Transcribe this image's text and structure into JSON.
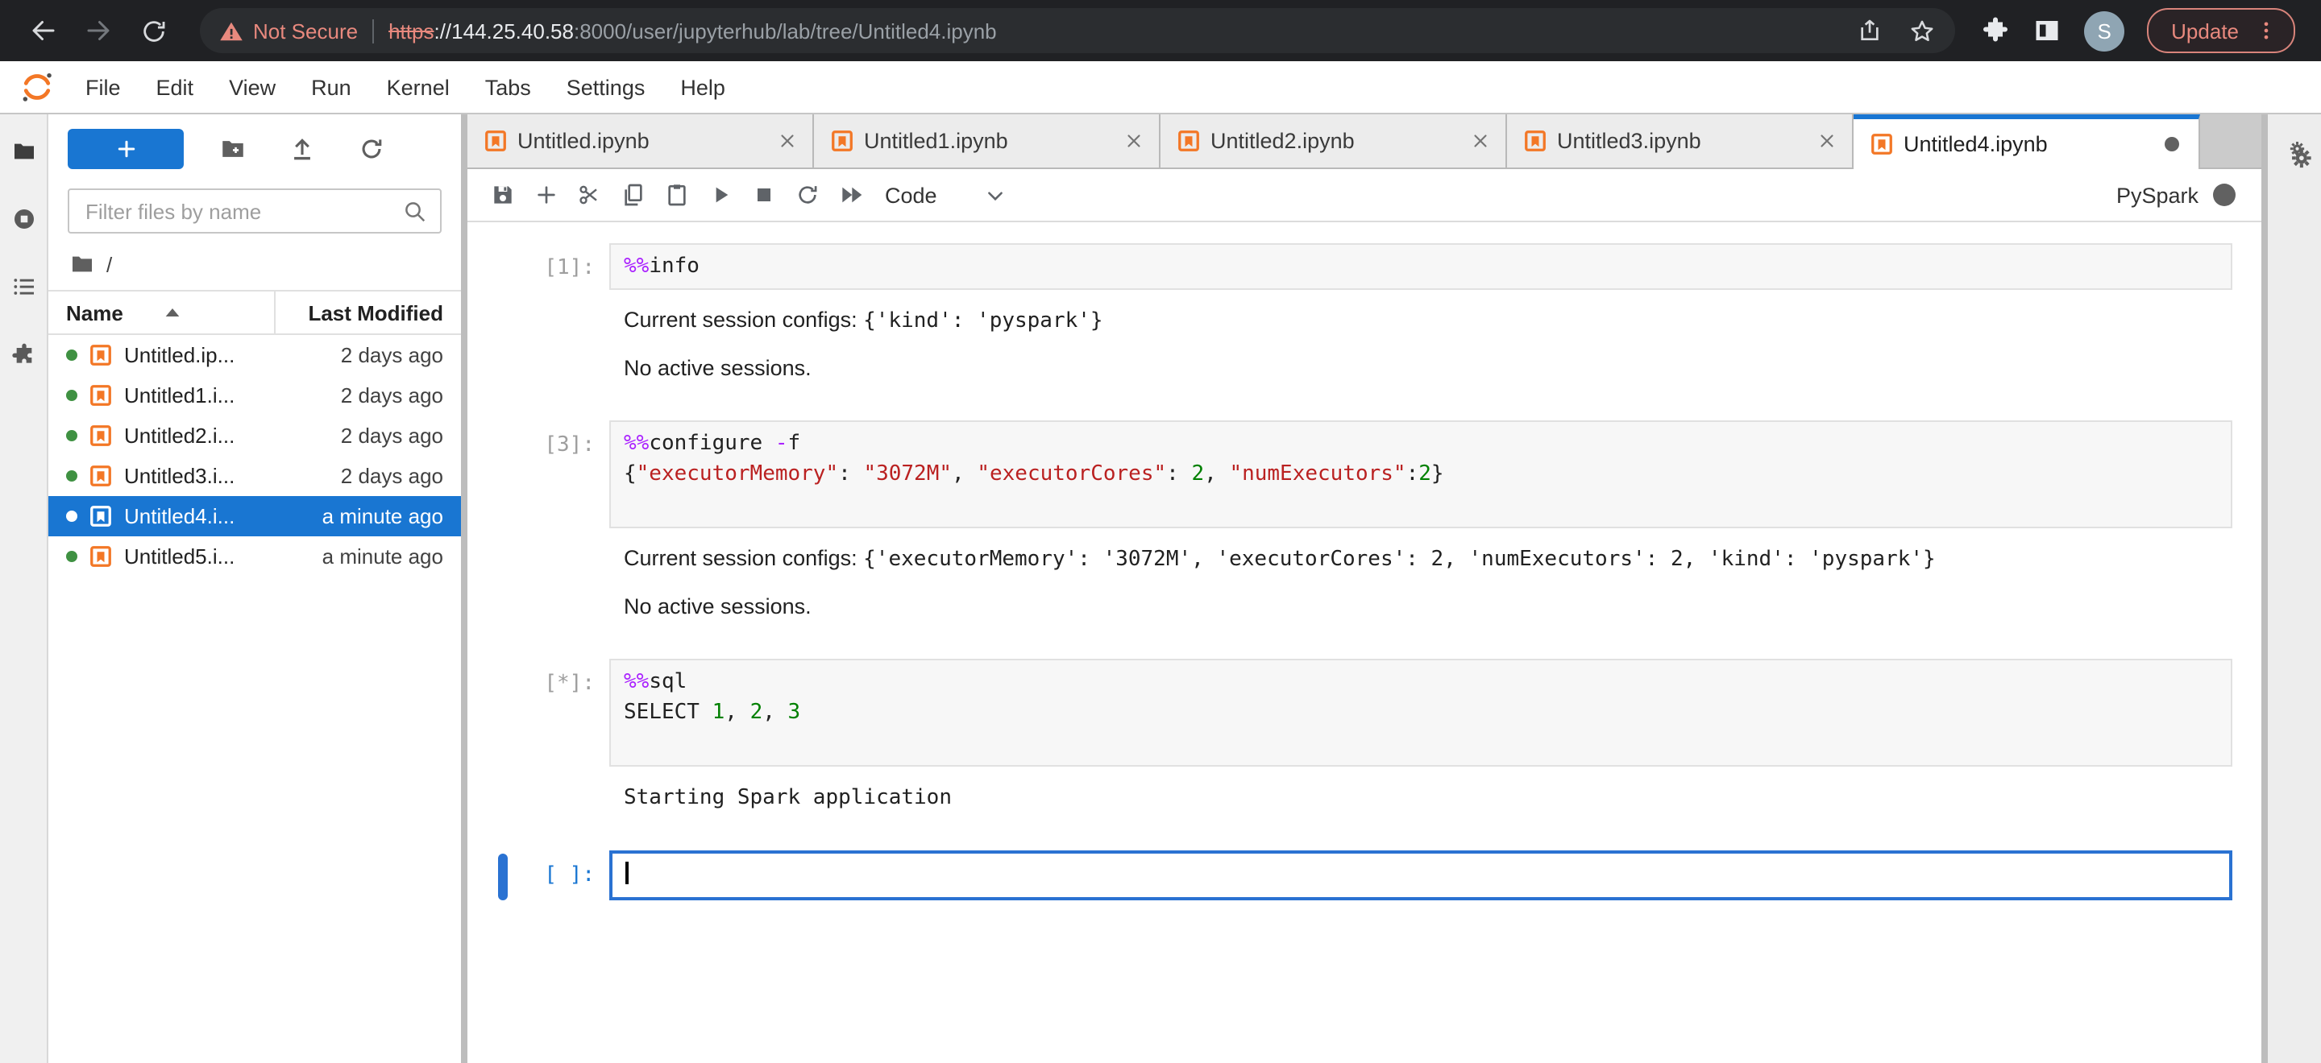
{
  "colors": {
    "brand_blue": "#1976d2",
    "jupyter_orange": "#f37726",
    "chrome_dark": "#202124",
    "warning_salmon": "#e8897e",
    "selection_blue": "#1976d2",
    "kernel_busy": "#616161",
    "running_green": "#3f9142"
  },
  "browser": {
    "not_secure_label": "Not Secure",
    "url": {
      "scheme": "https",
      "sep": "://",
      "host": "144.25.40.58",
      "rest": ":8000/user/jupyterhub/lab/tree/Untitled4.ipynb"
    },
    "avatar_initial": "S",
    "update_label": "Update"
  },
  "menubar": {
    "items": [
      "File",
      "Edit",
      "View",
      "Run",
      "Kernel",
      "Tabs",
      "Settings",
      "Help"
    ]
  },
  "activity_bar": {
    "items": [
      {
        "icon": "folder",
        "active": true
      },
      {
        "icon": "running",
        "active": false
      },
      {
        "icon": "toc",
        "active": false
      },
      {
        "icon": "extensions",
        "active": false
      }
    ]
  },
  "file_browser": {
    "new_launcher_label": "+",
    "filter_placeholder": "Filter files by name",
    "breadcrumb": "/",
    "columns": {
      "name": "Name",
      "modified": "Last Modified"
    },
    "files": [
      {
        "name": "Untitled.ip...",
        "modified": "2 days ago",
        "selected": false
      },
      {
        "name": "Untitled1.i...",
        "modified": "2 days ago",
        "selected": false
      },
      {
        "name": "Untitled2.i...",
        "modified": "2 days ago",
        "selected": false
      },
      {
        "name": "Untitled3.i...",
        "modified": "2 days ago",
        "selected": false
      },
      {
        "name": "Untitled4.i...",
        "modified": "a minute ago",
        "selected": true
      },
      {
        "name": "Untitled5.i...",
        "modified": "a minute ago",
        "selected": false
      }
    ]
  },
  "dock": {
    "tabs": [
      {
        "title": "Untitled.ipynb",
        "dirty": false,
        "active": false
      },
      {
        "title": "Untitled1.ipynb",
        "dirty": false,
        "active": false
      },
      {
        "title": "Untitled2.ipynb",
        "dirty": false,
        "active": false
      },
      {
        "title": "Untitled3.ipynb",
        "dirty": false,
        "active": false
      },
      {
        "title": "Untitled4.ipynb",
        "dirty": true,
        "active": true
      }
    ],
    "toolbar": {
      "icons": [
        "save",
        "add",
        "cut",
        "copy",
        "paste",
        "run",
        "stop",
        "restart",
        "run-all"
      ],
      "cell_type": "Code",
      "kernel_name": "PySpark"
    }
  },
  "notebook": {
    "cells": [
      {
        "prompt": "[1]:",
        "active": false,
        "pad_lines": 0,
        "code": [
          [
            {
              "t": "%%",
              "c": "magic"
            },
            {
              "t": "info",
              "c": "plain"
            }
          ]
        ],
        "outputs": [
          {
            "parts": [
              {
                "t": "Current session configs: ",
                "f": "sans"
              },
              {
                "t": "{'kind': 'pyspark'}",
                "f": "mono"
              }
            ]
          },
          {
            "parts": [
              {
                "t": "No active sessions.",
                "f": "sans"
              }
            ]
          }
        ]
      },
      {
        "prompt": "[3]:",
        "active": false,
        "pad_lines": 1,
        "code": [
          [
            {
              "t": "%%",
              "c": "magic"
            },
            {
              "t": "configure ",
              "c": "plain"
            },
            {
              "t": "-",
              "c": "magic"
            },
            {
              "t": "f",
              "c": "plain"
            }
          ],
          [
            {
              "t": "{",
              "c": "plain"
            },
            {
              "t": "\"executorMemory\"",
              "c": "string"
            },
            {
              "t": ": ",
              "c": "plain"
            },
            {
              "t": "\"3072M\"",
              "c": "string"
            },
            {
              "t": ", ",
              "c": "plain"
            },
            {
              "t": "\"executorCores\"",
              "c": "string"
            },
            {
              "t": ": ",
              "c": "plain"
            },
            {
              "t": "2",
              "c": "number"
            },
            {
              "t": ", ",
              "c": "plain"
            },
            {
              "t": "\"numExecutors\"",
              "c": "string"
            },
            {
              "t": ":",
              "c": "plain"
            },
            {
              "t": "2",
              "c": "number"
            },
            {
              "t": "}",
              "c": "plain"
            }
          ]
        ],
        "outputs": [
          {
            "parts": [
              {
                "t": "Current session configs: ",
                "f": "sans"
              },
              {
                "t": "{'executorMemory': '3072M', 'executorCores': 2, 'numExecutors': 2, 'kind': 'pyspark'}",
                "f": "mono"
              }
            ]
          },
          {
            "parts": [
              {
                "t": "No active sessions.",
                "f": "sans"
              }
            ]
          }
        ]
      },
      {
        "prompt": "[*]:",
        "active": false,
        "pad_lines": 1,
        "code": [
          [
            {
              "t": "%%",
              "c": "magic"
            },
            {
              "t": "sql",
              "c": "plain"
            }
          ],
          [
            {
              "t": "SELECT ",
              "c": "plain"
            },
            {
              "t": "1",
              "c": "number"
            },
            {
              "t": ", ",
              "c": "plain"
            },
            {
              "t": "2",
              "c": "number"
            },
            {
              "t": ", ",
              "c": "plain"
            },
            {
              "t": "3",
              "c": "number"
            }
          ]
        ],
        "outputs": [
          {
            "parts": [
              {
                "t": "Starting Spark application",
                "f": "mono"
              }
            ]
          }
        ]
      },
      {
        "prompt": "[ ]:",
        "active": true,
        "pad_lines": 0,
        "code": [],
        "outputs": []
      }
    ]
  }
}
